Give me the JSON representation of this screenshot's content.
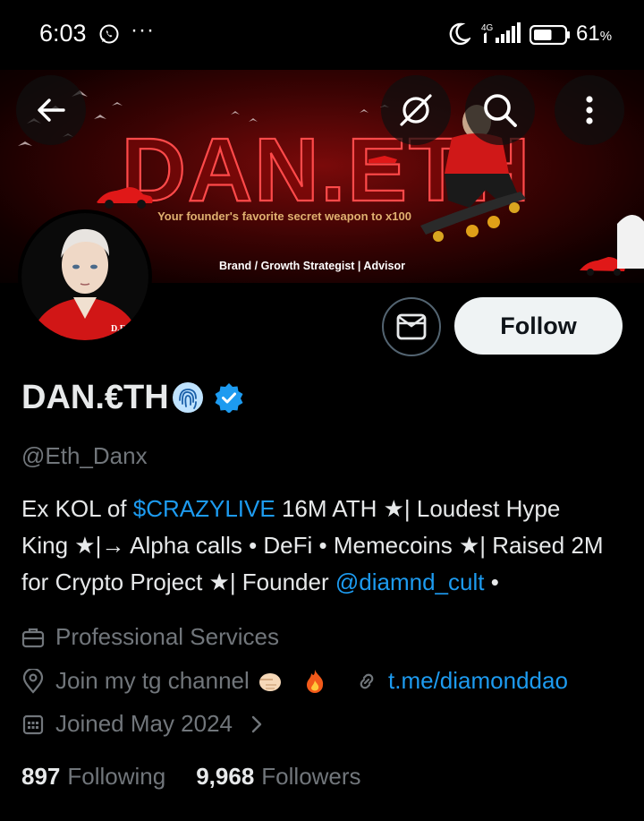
{
  "status_bar": {
    "time": "6:03",
    "overflow": "···",
    "network": "4G",
    "battery_pct": "61",
    "battery_unit": "%",
    "battery_level": 0.61
  },
  "banner": {
    "title": "DAN.ETH",
    "tagline": "Your founder's favorite secret weapon to x100",
    "subtitle": "Brand / Growth Strategist | Advisor",
    "colors": {
      "bg": "#3b0303",
      "accent": "#e02020"
    }
  },
  "avatar": {
    "badge_text": "D.E"
  },
  "header_buttons": {
    "back": "back-arrow-icon",
    "grok": "grok-icon",
    "search": "search-icon",
    "more": "more-vertical-icon"
  },
  "actions": {
    "message_icon": "envelope-icon",
    "follow_label": "Follow"
  },
  "profile": {
    "display_name": "DAN.€TH",
    "name_emoji": "fingerprint-icon",
    "verified": true,
    "handle": "@Eth_Danx",
    "bio": {
      "p1": "Ex KOL of ",
      "link1": "$CRAZYLIVE",
      "p2": " 16M ATH ★| Loudest Hype King ★|→ Alpha calls • DeFi • Memecoins ★| Raised 2M for Crypto Project ★| Founder ",
      "link2": "@diamnd_cult",
      "p3": " •"
    },
    "category": "Professional Services",
    "location": "Join my tg channel",
    "url": "t.me/diamonddao",
    "joined": "Joined May 2024",
    "following_count": "897",
    "following_label": "Following",
    "followers_count": "9,968",
    "followers_label": "Followers"
  },
  "colors": {
    "background": "#000000",
    "text": "#e7e9ea",
    "muted": "#71767b",
    "link": "#1d9bf0",
    "verified": "#1d9bf0"
  }
}
